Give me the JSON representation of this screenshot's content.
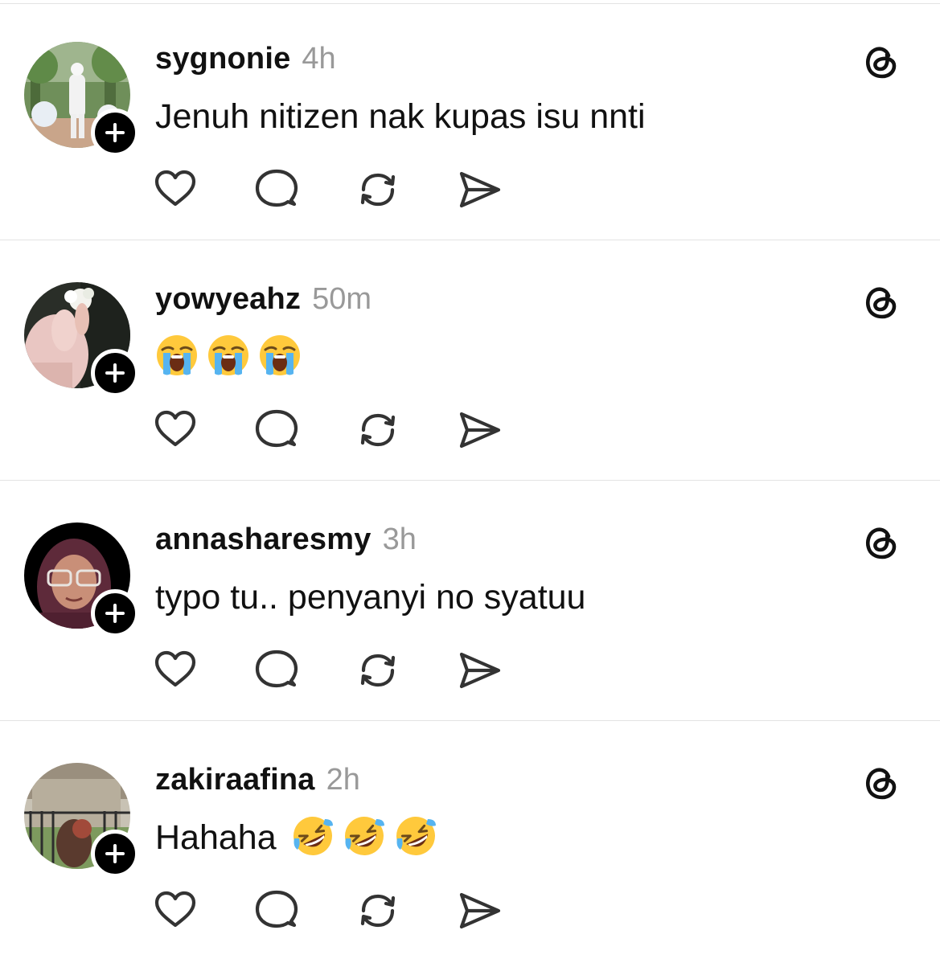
{
  "posts": [
    {
      "username": "sygnonie",
      "time": "4h",
      "text": "Jenuh nitizen nak kupas isu nnti",
      "emojis": []
    },
    {
      "username": "yowyeahz",
      "time": "50m",
      "text": "",
      "emojis": [
        "loudly-crying-face",
        "loudly-crying-face",
        "loudly-crying-face"
      ]
    },
    {
      "username": "annasharesmy",
      "time": "3h",
      "text": "typo tu.. penyanyi no syatuu",
      "emojis": []
    },
    {
      "username": "zakiraafina",
      "time": "2h",
      "text": "Hahaha",
      "emojis": [
        "rolling-on-the-floor-laughing",
        "rolling-on-the-floor-laughing",
        "rolling-on-the-floor-laughing"
      ]
    }
  ],
  "icons": {
    "follow": "plus-icon",
    "brand": "threads-logo-icon",
    "actions": [
      "heart-icon",
      "reply-bubble-icon",
      "repost-icon",
      "share-send-icon"
    ]
  },
  "colors": {
    "text": "#111111",
    "timestamp": "#999999",
    "divider": "#e3e3e3",
    "badge": "#000000"
  }
}
